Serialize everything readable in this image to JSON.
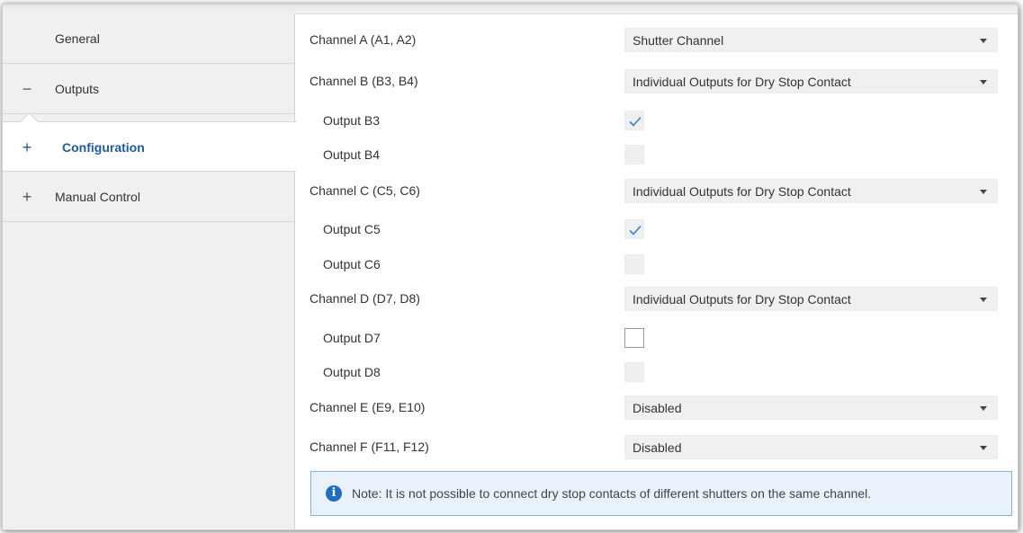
{
  "sidebar": {
    "items": [
      {
        "sign": "",
        "label": "General"
      },
      {
        "sign": "−",
        "label": "Outputs"
      },
      {
        "sign": "+",
        "label": "Configuration"
      },
      {
        "sign": "+",
        "label": "Manual Control"
      }
    ]
  },
  "channels": {
    "a": {
      "label": "Channel A (A1, A2)",
      "value": "Shutter Channel"
    },
    "b": {
      "label": "Channel B (B3, B4)",
      "value": "Individual Outputs for Dry Stop Contact"
    },
    "b3": {
      "label": "Output B3",
      "checked": true
    },
    "b4": {
      "label": "Output B4",
      "checked": false
    },
    "c": {
      "label": "Channel C (C5, C6)",
      "value": "Individual Outputs for Dry Stop Contact"
    },
    "c5": {
      "label": "Output C5",
      "checked": true
    },
    "c6": {
      "label": "Output C6",
      "checked": false
    },
    "d": {
      "label": "Channel D (D7, D8)",
      "value": "Individual Outputs for Dry Stop Contact"
    },
    "d7": {
      "label": "Output D7",
      "checked": false
    },
    "d8": {
      "label": "Output D8",
      "checked": false
    },
    "e": {
      "label": "Channel E (E9, E10)",
      "value": "Disabled"
    },
    "f": {
      "label": "Channel F (F11, F12)",
      "value": "Disabled"
    }
  },
  "note": {
    "icon": "info-icon",
    "text": "Note: It is not possible to connect dry stop contacts of different shutters on the same channel."
  },
  "colors": {
    "accent": "#1f5b9c",
    "check": "#3a7fc8",
    "note_bg": "#e9f2fa",
    "note_border": "#86b3db"
  }
}
